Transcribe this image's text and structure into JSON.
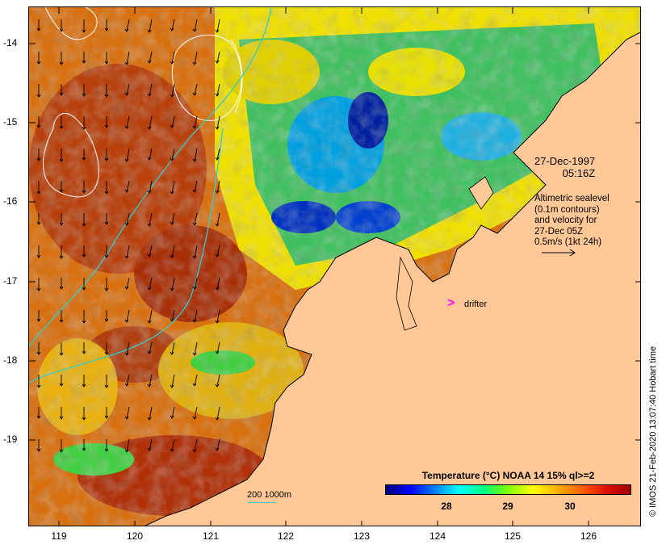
{
  "map": {
    "date": "27-Dec-1997",
    "time": "05:16Z",
    "altimetry_lines": [
      "Altimetric sealevel",
      "(0.1m contours)",
      "and velocity for",
      "27-Dec 05Z",
      "0.5m/s (1kt 24h)"
    ],
    "drifter_label": "drifter",
    "drifter_mark": ">",
    "isobath_legend": "200  1000m",
    "credit": "© IMOS 21-Feb-2020 13:07:40 Hobart time",
    "colors": {
      "land": "#ffc896",
      "drifter": "#ff00ff",
      "isobath": "#33cccc",
      "contour": "#ffffff"
    }
  },
  "axes": {
    "lat_ticks": [
      "-14",
      "-15",
      "-16",
      "-17",
      "-18",
      "-19"
    ],
    "lon_ticks": [
      "119",
      "120",
      "121",
      "122",
      "123",
      "124",
      "125",
      "126"
    ]
  },
  "colorbar": {
    "title": "Temperature (°C) NOAA 14 15% ql>=2",
    "ticks": [
      "28",
      "29",
      "30"
    ],
    "range": [
      27,
      31
    ]
  }
}
